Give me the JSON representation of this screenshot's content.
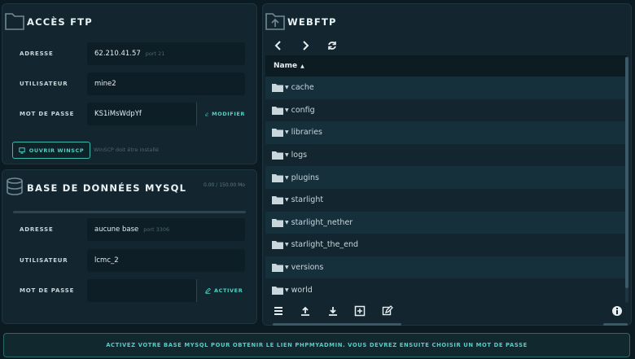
{
  "ftp": {
    "title": "Accès FTP",
    "address_label": "Adresse",
    "address_value": "62.210.41.57",
    "address_port": "port 21",
    "user_label": "Utilisateur",
    "user_value": "mine2",
    "password_label": "Mot de passe",
    "password_value": "KS1iMsWdpYf",
    "modify_label": "Modifier",
    "winscp_label": "Ouvrir WinSCP",
    "winscp_note": "WinSCP doit être installé"
  },
  "mysql": {
    "title": "Base de données MySQL",
    "size": "0.00 / 150.00 Mo",
    "usage_fraction": 0.0,
    "address_label": "Adresse",
    "address_value": "aucune base",
    "address_port": "port 3306",
    "user_label": "Utilisateur",
    "user_value": "lcmc_2",
    "password_label": "Mot de passe",
    "password_value": "",
    "activate_label": "Activer"
  },
  "webftp": {
    "title": "WebFTP",
    "column_name": "Name",
    "files": [
      "cache",
      "config",
      "libraries",
      "logs",
      "plugins",
      "starlight",
      "starlight_nether",
      "starlight_the_end",
      "versions",
      "world"
    ]
  },
  "footer": {
    "message": "Activez votre base MySQL pour obtenir le lien phpMyAdmin. Vous devrez ensuite choisir un mot de passe"
  },
  "colors": {
    "accent": "#4fd1c5",
    "panel": "#13262f",
    "background": "#0c1a22"
  },
  "icons": {
    "ftp": "folder-icon",
    "mysql": "database-icon",
    "webftp": "folder-upload-icon"
  }
}
